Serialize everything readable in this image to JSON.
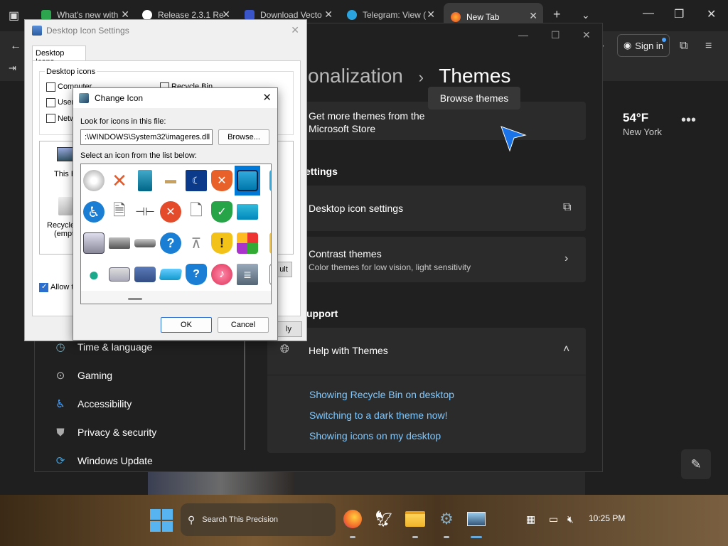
{
  "browser": {
    "tabs": [
      {
        "label": "What's new with",
        "icon": "github-icon"
      },
      {
        "label": "Release 2.3.1 Re",
        "icon": "github-icon"
      },
      {
        "label": "Download Vecto",
        "icon": "vector-icon"
      },
      {
        "label": "Telegram: View (",
        "icon": "telegram-icon"
      },
      {
        "label": "New Tab",
        "icon": "firefox-icon"
      }
    ],
    "signin_label": "Sign in"
  },
  "weather": {
    "temp": "54°F",
    "city": "New York"
  },
  "settings": {
    "title_dim": "onalization",
    "title_sep": "›",
    "title": "Themes",
    "store_text_1": "Get more themes from the",
    "store_text_2": "Microsoft Store",
    "browse_label": "Browse themes",
    "section_settings": "ettings",
    "desktop_icon_settings": "Desktop icon settings",
    "contrast_title": "Contrast themes",
    "contrast_sub": "Color themes for low vision, light sensitivity",
    "section_support": "upport",
    "help_title": "Help with Themes",
    "links": [
      "Showing Recycle Bin on desktop",
      "Switching to a dark theme now!",
      "Showing icons on my desktop"
    ],
    "nav": [
      {
        "label": "Time & language",
        "icon": "clock-globe-icon"
      },
      {
        "label": "Gaming",
        "icon": "gamepad-icon"
      },
      {
        "label": "Accessibility",
        "icon": "accessibility-icon"
      },
      {
        "label": "Privacy & security",
        "icon": "shield-icon"
      },
      {
        "label": "Windows Update",
        "icon": "update-icon"
      }
    ]
  },
  "desktop_icon_dialog": {
    "title": "Desktop Icon Settings",
    "tab": "Desktop Icons",
    "group_label": "Desktop icons",
    "checkbox_computer": "Computer",
    "checkbox_user": "User",
    "checkbox_network": "Netw",
    "checkbox_recycle": "Recycle Bin",
    "icon_this_pc": "This P",
    "icon_recycle_1": "Recycle",
    "icon_recycle_2": "(empt",
    "allow_label": "Allow t",
    "default_btn": "ult",
    "apply_btn": "ly"
  },
  "change_icon_dialog": {
    "title": "Change Icon",
    "look_label": "Look for icons in this file:",
    "path": ":\\WINDOWS\\System32\\imageres.dll",
    "browse_label": "Browse...",
    "select_label": "Select an icon from the list below:",
    "ok_label": "OK",
    "cancel_label": "Cancel"
  },
  "taskbar": {
    "search_placeholder": "Search This Precision",
    "clock": "10:25 PM"
  },
  "colors": {
    "accent": "#0078d7",
    "link": "#7fc8ff",
    "cursor": "#1a73e8"
  }
}
